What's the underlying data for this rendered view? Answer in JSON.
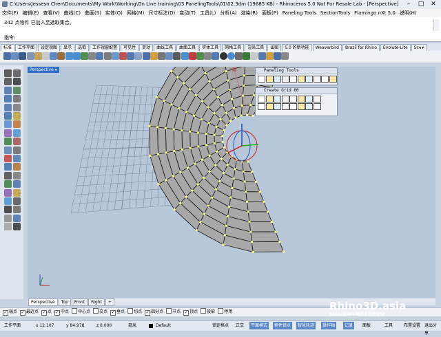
{
  "window": {
    "title": "C:\\Users\\Jessesn Chen\\Documents\\My Work\\Working\\On Line training\\03 PanelingTools\\01\\02.3dm (19685 KB) - Rhinoceros 5.0 Not For Resale Lab - [Perspective]"
  },
  "menu": [
    "文件(F)",
    "编辑(E)",
    "查看(V)",
    "曲线(C)",
    "曲面(S)",
    "实体(O)",
    "网格(M)",
    "尺寸标注(D)",
    "变动(T)",
    "工具(L)",
    "分析(A)",
    "渲染(R)",
    "面板(P)",
    "Paneling Tools",
    "SectionTools",
    "Flamingo nXt 5.0",
    "说明(H)"
  ],
  "command": {
    "history": "342 点物件 已加入至选取集合。",
    "prompt": "指令:"
  },
  "toolbar_tabs": [
    "标准",
    "工作平面",
    "设定视图",
    "显示",
    "选取",
    "工作视窗配置",
    "可见性",
    "变动",
    "曲线工具",
    "曲面工具",
    "实体工具",
    "网格工具",
    "渲染工具",
    "出图",
    "5.0 的新功能",
    "Weaverbird",
    "Brazil for Rhino",
    "Evolute-Lite",
    "Sc◂ ▸"
  ],
  "viewport": {
    "name": "Perspective"
  },
  "panels": {
    "paneling_title": "Paneling Tools",
    "grid_title": "Create Grid 00"
  },
  "view_tabs": [
    "Perspective",
    "Top",
    "Front",
    "Right"
  ],
  "osnaps": [
    {
      "label": "端点",
      "checked": true
    },
    {
      "label": "最近点",
      "checked": true
    },
    {
      "label": "点",
      "checked": true
    },
    {
      "label": "中点",
      "checked": true
    },
    {
      "label": "中心点",
      "checked": false
    },
    {
      "label": "交点",
      "checked": false
    },
    {
      "label": "垂点",
      "checked": true
    },
    {
      "label": "切点",
      "checked": false
    },
    {
      "label": "四分点",
      "checked": true
    },
    {
      "label": "节点",
      "checked": false
    },
    {
      "label": "顶点",
      "checked": true
    },
    {
      "label": "投影",
      "checked": false
    },
    {
      "label": "停用",
      "checked": false
    }
  ],
  "status": {
    "cplane": "工作平面",
    "x": "x 12.107",
    "y": "y 84.978",
    "z": "z 0.000",
    "units": "毫米",
    "layer": "Default",
    "buttons": [
      "锁定格点",
      "正交",
      "平面模式",
      "物件锁点",
      "智慧轨迹",
      "操作轴",
      "记录"
    ],
    "right": [
      "面板",
      "工具",
      "布置设置",
      "退出分享"
    ]
  },
  "watermark": {
    "text": "Rhino3D.asia",
    "sub": "Rhino亚洲中国技术交流论坛"
  },
  "colors": {
    "viewport_bg": "#b8c7da",
    "grid_line": "#7c8796",
    "panel_fill": "#a8a8a8",
    "point_color": "#ffff80",
    "active_blue": "#2f6dc9"
  }
}
